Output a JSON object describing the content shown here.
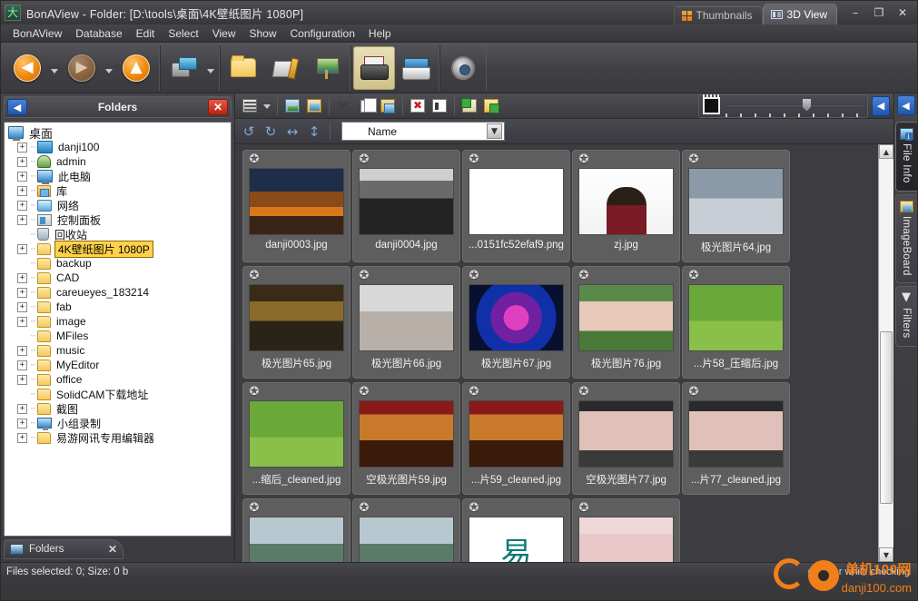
{
  "window": {
    "title": "BonAView - Folder: [D:\\tools\\桌面\\4K壁纸图片 1080P]",
    "app_icon": "大",
    "minimize": "–",
    "maximize": "❐",
    "close": "✕",
    "tabs": [
      {
        "label": "Thumbnails",
        "icon": "four-squares-icon",
        "active": false
      },
      {
        "label": "3D View",
        "icon": "cube-view-icon",
        "active": true
      }
    ]
  },
  "menubar": [
    {
      "label": "BonAView"
    },
    {
      "label": "Database"
    },
    {
      "label": "Edit"
    },
    {
      "label": "Select"
    },
    {
      "label": "View"
    },
    {
      "label": "Show"
    },
    {
      "label": "Configuration"
    },
    {
      "label": "Help"
    }
  ],
  "toolbar": [
    {
      "name": "back-button",
      "icon": "arrow-left-icon",
      "glyph": "◀",
      "state": "enabled",
      "dropdown": true
    },
    {
      "name": "forward-button",
      "icon": "arrow-right-icon",
      "glyph": "▶",
      "state": "disabled",
      "dropdown": true
    },
    {
      "name": "up-button",
      "icon": "arrow-up-icon",
      "glyph": "▲",
      "state": "enabled",
      "dropdown": false
    },
    {
      "name": "import-button",
      "icon": "camera-import-icon",
      "state": "enabled",
      "dropdown": true
    },
    {
      "name": "open-folder-button",
      "icon": "folder-icon",
      "state": "enabled",
      "dropdown": false
    },
    {
      "name": "edit-image-button",
      "icon": "pen-ruler-icon",
      "state": "enabled",
      "dropdown": false
    },
    {
      "name": "easel-button",
      "icon": "easel-icon",
      "state": "enabled",
      "dropdown": false
    },
    {
      "name": "print-button",
      "icon": "printer-icon",
      "state": "highlighted",
      "dropdown": false
    },
    {
      "name": "scanner-button",
      "icon": "scanner-icon",
      "state": "enabled",
      "dropdown": false
    },
    {
      "name": "settings-button",
      "icon": "gear-icon",
      "state": "enabled",
      "dropdown": false
    }
  ],
  "folders_panel": {
    "title": "Folders",
    "collapse_icon": "◀",
    "close_icon": "✕",
    "bottom_tab": {
      "label": "Folders",
      "close": "✕",
      "icon": "monitor-icon"
    },
    "tree": [
      {
        "label": "桌面",
        "indent": 0,
        "expander": "",
        "icon": "desktop-icon",
        "selected": false
      },
      {
        "label": "danji100",
        "indent": 1,
        "expander": "+",
        "icon": "blue-folder-icon",
        "selected": false
      },
      {
        "label": "admin",
        "indent": 1,
        "expander": "+",
        "icon": "user-icon",
        "selected": false
      },
      {
        "label": "此电脑",
        "indent": 1,
        "expander": "+",
        "icon": "computer-icon",
        "selected": false
      },
      {
        "label": "库",
        "indent": 1,
        "expander": "+",
        "icon": "library-icon",
        "selected": false
      },
      {
        "label": "网络",
        "indent": 1,
        "expander": "+",
        "icon": "network-icon",
        "selected": false
      },
      {
        "label": "控制面板",
        "indent": 1,
        "expander": "+",
        "icon": "control-panel-icon",
        "selected": false
      },
      {
        "label": "回收站",
        "indent": 1,
        "expander": "",
        "icon": "recycle-bin-icon",
        "selected": false
      },
      {
        "label": "4K壁纸图片 1080P",
        "indent": 1,
        "expander": "+",
        "icon": "folder-icon",
        "selected": true
      },
      {
        "label": "backup",
        "indent": 1,
        "expander": "",
        "icon": "folder-icon",
        "selected": false
      },
      {
        "label": "CAD",
        "indent": 1,
        "expander": "+",
        "icon": "folder-icon",
        "selected": false
      },
      {
        "label": "careueyes_183214",
        "indent": 1,
        "expander": "+",
        "icon": "folder-icon",
        "selected": false
      },
      {
        "label": "fab",
        "indent": 1,
        "expander": "+",
        "icon": "folder-icon",
        "selected": false
      },
      {
        "label": "image",
        "indent": 1,
        "expander": "+",
        "icon": "folder-icon",
        "selected": false
      },
      {
        "label": "MFiles",
        "indent": 1,
        "expander": "",
        "icon": "folder-icon",
        "selected": false
      },
      {
        "label": "music",
        "indent": 1,
        "expander": "+",
        "icon": "folder-icon",
        "selected": false
      },
      {
        "label": "MyEditor",
        "indent": 1,
        "expander": "+",
        "icon": "folder-icon",
        "selected": false
      },
      {
        "label": "office",
        "indent": 1,
        "expander": "+",
        "icon": "folder-icon",
        "selected": false
      },
      {
        "label": "SolidCAM下载地址",
        "indent": 1,
        "expander": "",
        "icon": "folder-icon",
        "selected": false
      },
      {
        "label": "截图",
        "indent": 1,
        "expander": "+",
        "icon": "folder-icon",
        "selected": false
      },
      {
        "label": "小组录制",
        "indent": 1,
        "expander": "+",
        "icon": "monitor-icon",
        "selected": false
      },
      {
        "label": "易游网讯专用编辑器",
        "indent": 1,
        "expander": "+",
        "icon": "folder-icon",
        "selected": false
      }
    ]
  },
  "content_toolbar": {
    "buttons": [
      {
        "name": "view-mode-button",
        "icon": "list-view-icon",
        "dropdown": true
      },
      {
        "name": "copy-image-button",
        "icon": "image-copy-icon"
      },
      {
        "name": "paste-image-button",
        "icon": "image-paste-icon"
      },
      {
        "name": "cut-button",
        "icon": "scissors-icon",
        "glyph": "✂"
      },
      {
        "name": "copy-button",
        "icon": "copy-icon"
      },
      {
        "name": "paste-button",
        "icon": "clipboard-paste-icon"
      },
      {
        "name": "delete-button",
        "icon": "delete-x-icon",
        "glyph": "✖"
      },
      {
        "name": "rename-button",
        "icon": "rename-icon"
      },
      {
        "name": "add-image-button",
        "icon": "add-image-icon"
      },
      {
        "name": "add-folder-button",
        "icon": "add-folder-icon"
      }
    ],
    "zoom": {
      "icon": "thumbnail-size-icon",
      "slider_value": 56
    },
    "collapse_right_icon": "◀"
  },
  "sortbar": {
    "buttons": [
      {
        "name": "rotate-left-button",
        "icon": "rotate-left-icon",
        "glyph": "↺"
      },
      {
        "name": "rotate-right-button",
        "icon": "rotate-right-icon",
        "glyph": "↻"
      },
      {
        "name": "flip-horizontal-button",
        "icon": "flip-horizontal-icon",
        "glyph": "↔"
      },
      {
        "name": "flip-vertical-button",
        "icon": "flip-vertical-icon",
        "glyph": "↕"
      }
    ],
    "sort_select": {
      "value": "Name",
      "arrow": "▼"
    }
  },
  "thumbnails": [
    {
      "label": "danji0003.jpg",
      "art": "sunset",
      "pin": "sunset-thumb"
    },
    {
      "label": "danji0004.jpg",
      "art": "bw",
      "pin": "bw-thumb"
    },
    {
      "label": "...0151fc52efaf9.png",
      "art": "icon",
      "pin": "icon-thumb"
    },
    {
      "label": "zj.jpg",
      "art": "portrait",
      "pin": "portrait-thumb"
    },
    {
      "label": "极光图片64.jpg",
      "art": "snow",
      "pin": "snow-thumb"
    },
    {
      "label": "极光图片65.jpg",
      "art": "street",
      "pin": "street-thumb"
    },
    {
      "label": "极光图片66.jpg",
      "art": "room",
      "pin": "room-thumb"
    },
    {
      "label": "极光图片67.jpg",
      "art": "neon",
      "pin": "neon-thumb"
    },
    {
      "label": "极光图片76.jpg",
      "art": "anime",
      "pin": "anime-thumb"
    },
    {
      "label": "...片58_压缩后.jpg",
      "art": "field",
      "pin": "field-thumb"
    },
    {
      "label": "...缩后_cleaned.jpg",
      "art": "field",
      "pin": "field2-thumb"
    },
    {
      "label": "空极光图片59.jpg",
      "art": "candle",
      "pin": "candle-thumb"
    },
    {
      "label": "...片59_cleaned.jpg",
      "art": "candle",
      "pin": "candle2-thumb"
    },
    {
      "label": "空极光图片77.jpg",
      "art": "face",
      "pin": "face-thumb"
    },
    {
      "label": "...片77_cleaned.jpg",
      "art": "face",
      "pin": "face2-thumb"
    },
    {
      "label": "",
      "art": "dragon",
      "pin": "dragon-thumb",
      "clipped": true
    },
    {
      "label": "",
      "art": "dragon",
      "pin": "dragon2-thumb",
      "clipped": true
    },
    {
      "label": "",
      "art": "logo",
      "pin": "logo-thumb",
      "clipped": true
    },
    {
      "label": "",
      "art": "balloon",
      "pin": "balloon-thumb",
      "clipped": true
    }
  ],
  "right_tabs": [
    {
      "label": "File Info",
      "icon": "file-info-icon",
      "active": true
    },
    {
      "label": "ImageBoard",
      "icon": "imageboard-icon",
      "active": false
    },
    {
      "label": "Filters",
      "icon": "funnel-icon",
      "active": false
    }
  ],
  "scrollbar": {
    "up_arrow": "▲",
    "down_arrow": "▼"
  },
  "statusbar": {
    "left": "Files selected: 0; Size: 0 b",
    "right": "Error while checking"
  },
  "watermark": {
    "line1": "单机100网",
    "line2": "danji100.com"
  }
}
